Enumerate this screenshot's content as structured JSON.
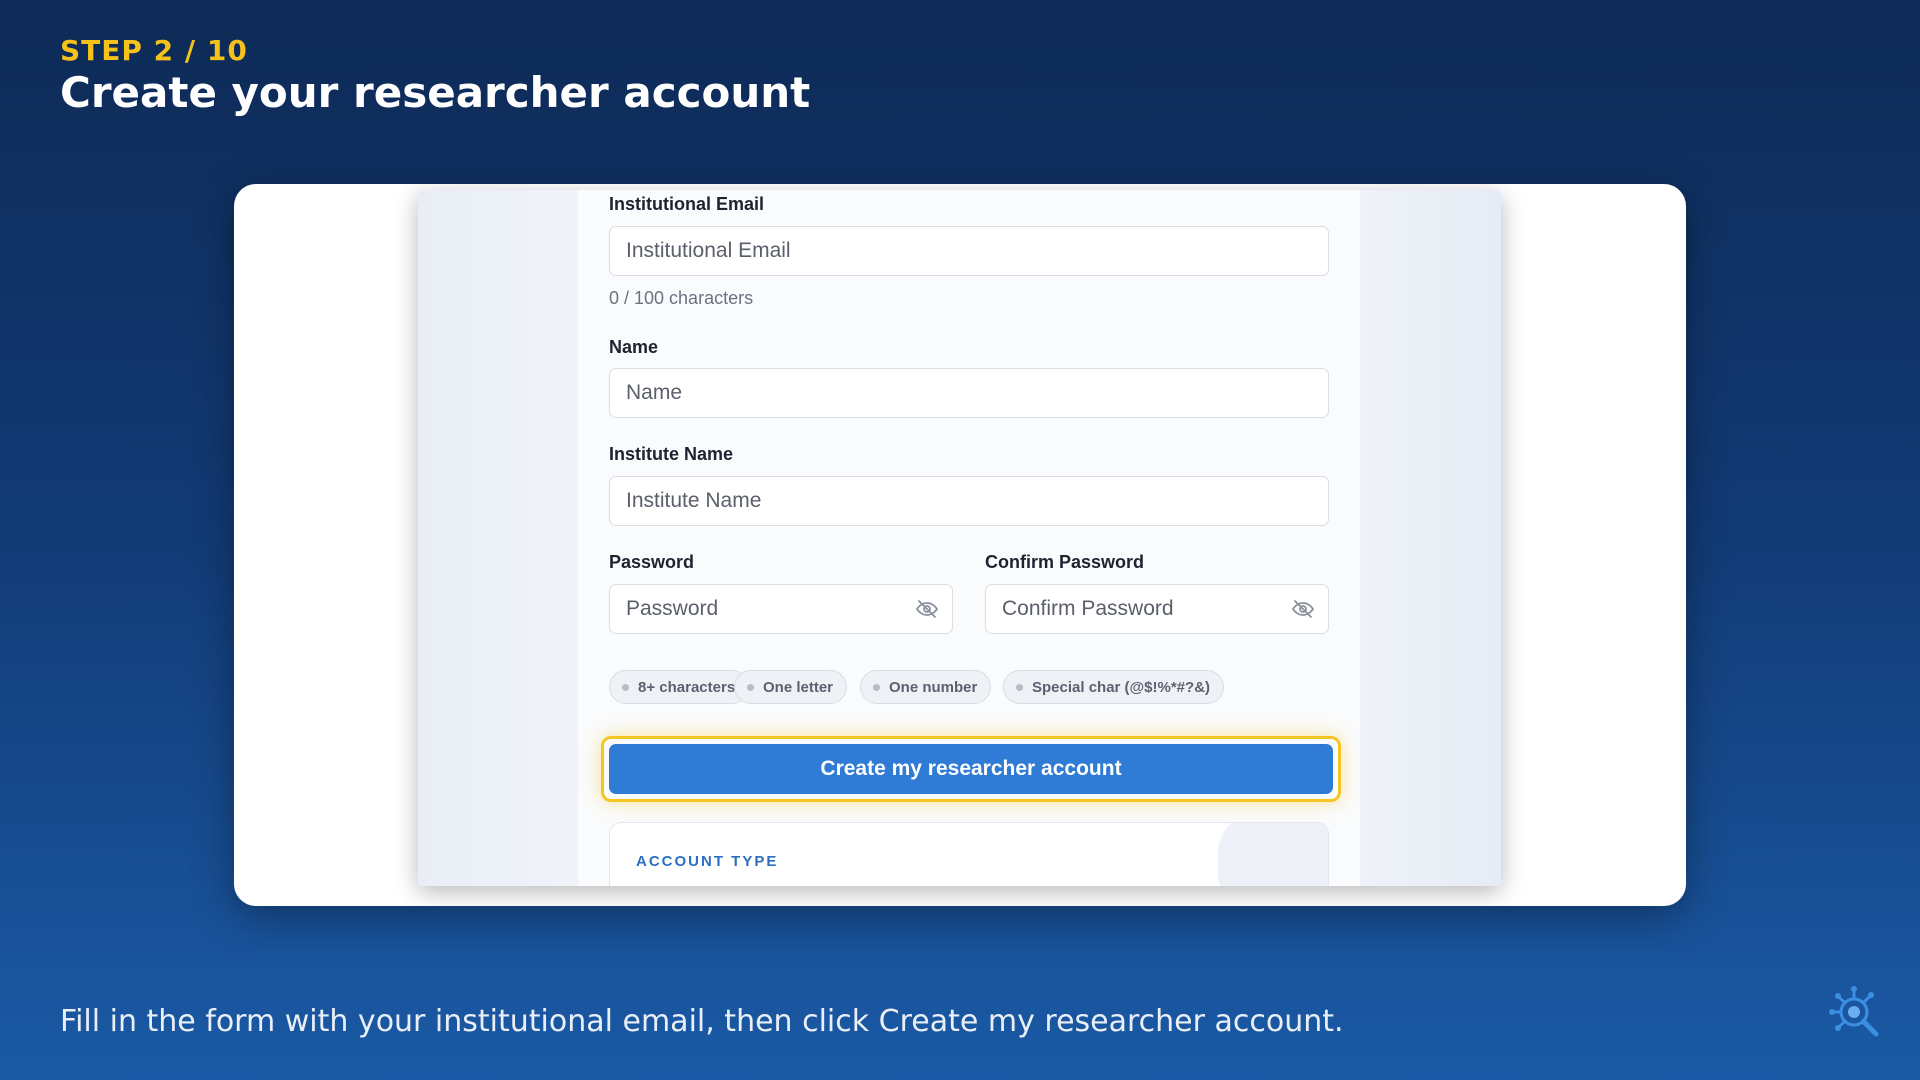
{
  "slide": {
    "step": "STEP 2 / 10",
    "title": "Create your researcher account",
    "caption": "Fill in the form with your institutional email, then click Create my researcher account."
  },
  "form": {
    "email": {
      "label": "Institutional Email",
      "placeholder": "Institutional Email",
      "value": "",
      "counter": "0 / 100 characters"
    },
    "name": {
      "label": "Name",
      "placeholder": "Name",
      "value": ""
    },
    "institute": {
      "label": "Institute Name",
      "placeholder": "Institute Name",
      "value": ""
    },
    "password": {
      "label": "Password",
      "placeholder": "Password",
      "value": "",
      "toggle_icon": "eye-off-icon"
    },
    "confirm_password": {
      "label": "Confirm Password",
      "placeholder": "Confirm Password",
      "value": "",
      "toggle_icon": "eye-off-icon"
    },
    "requirements": [
      "8+ characters",
      "One letter",
      "One number",
      "Special char (@$!%*#?&)"
    ],
    "submit_label": "Create my researcher account",
    "account_type_heading": "ACCOUNT TYPE"
  },
  "colors": {
    "step_accent": "#f4c21a",
    "primary_button": "#2f7bd6",
    "highlight_ring": "#f3c623",
    "background_top": "#0e2a56",
    "background_bottom": "#1b5aa6",
    "account_type_text": "#2c6fbf"
  },
  "icons": {
    "brand": "virus-magnifier-icon"
  }
}
